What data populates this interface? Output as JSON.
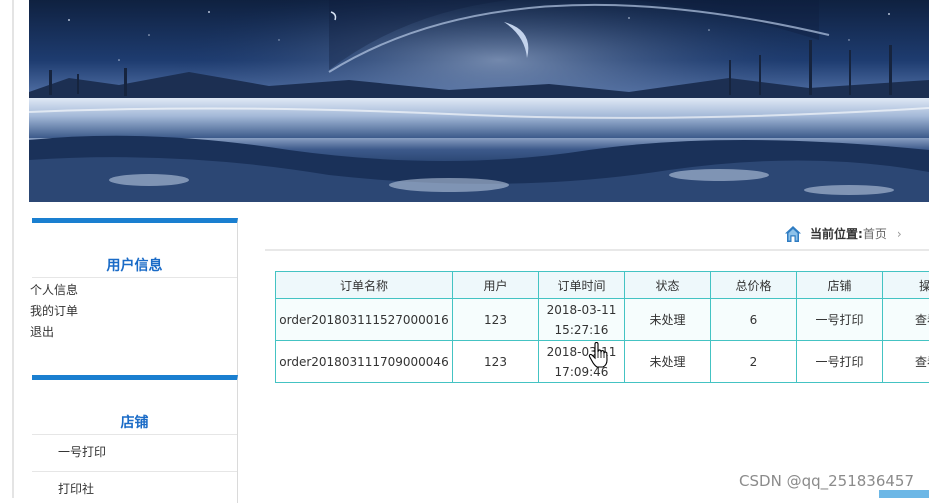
{
  "sidebar": {
    "user_section": {
      "title": "用户信息",
      "items": [
        "个人信息",
        "我的订单",
        "退出"
      ]
    },
    "shop_section": {
      "title": "店铺",
      "items": [
        "一号打印",
        "打印社"
      ]
    }
  },
  "breadcrumb": {
    "label": "当前位置:",
    "current": "首页",
    "icon": "home-icon",
    "separator_icon": "chevron-right-icon"
  },
  "orders_table": {
    "columns": [
      "订单名称",
      "用户",
      "订单时间",
      "状态",
      "总价格",
      "店铺",
      "操作"
    ],
    "rows": [
      {
        "name": "order201803111527000016",
        "user": "123",
        "date": "2018-03-11",
        "time": "15:27:16",
        "status": "未处理",
        "total": "6",
        "shop": "一号打印",
        "action": "查看"
      },
      {
        "name": "order201803111709000046",
        "user": "123",
        "date": "2018-03-11",
        "time": "17:09:46",
        "status": "未处理",
        "total": "2",
        "shop": "一号打印",
        "action": "查看"
      }
    ]
  },
  "watermark": "CSDN @qq_251836457",
  "colors": {
    "accent_blue": "#1a7fd0",
    "title_blue": "#1a6bc7",
    "table_border": "#44c3c3"
  }
}
